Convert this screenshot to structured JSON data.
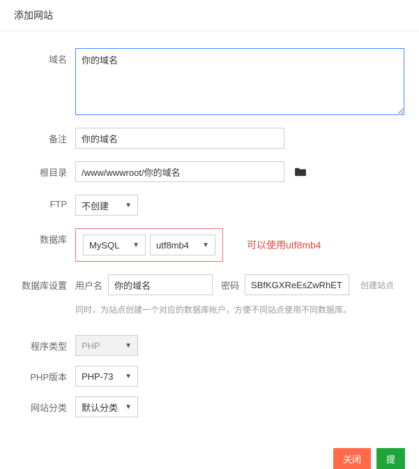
{
  "header": {
    "title": "添加网站"
  },
  "form": {
    "domain": {
      "label": "域名",
      "value": "你的域名"
    },
    "remark": {
      "label": "备注",
      "value": "你的域名"
    },
    "root": {
      "label": "根目录",
      "value": "/www/wwwroot/你的域名"
    },
    "ftp": {
      "label": "FTP",
      "value": "不创建"
    },
    "database": {
      "label": "数据库",
      "type_value": "MySQL",
      "charset_value": "utf8mb4",
      "annotation": "可以使用utf8mb4"
    },
    "db_settings": {
      "label": "数据库设置",
      "user_label": "用户名",
      "user_value": "你的域名",
      "pass_label": "密码",
      "pass_value": "SBfKGXReEsZwRhET",
      "create_link": "创建站点",
      "hint": "同时，为站点创建一个对应的数据库帐户，方便不同站点使用不同数据库。"
    },
    "program_type": {
      "label": "程序类型",
      "value": "PHP"
    },
    "php_version": {
      "label": "PHP版本",
      "value": "PHP-73"
    },
    "site_category": {
      "label": "网站分类",
      "value": "默认分类"
    }
  },
  "footer": {
    "close_label": "关闭",
    "submit_label": "提"
  }
}
